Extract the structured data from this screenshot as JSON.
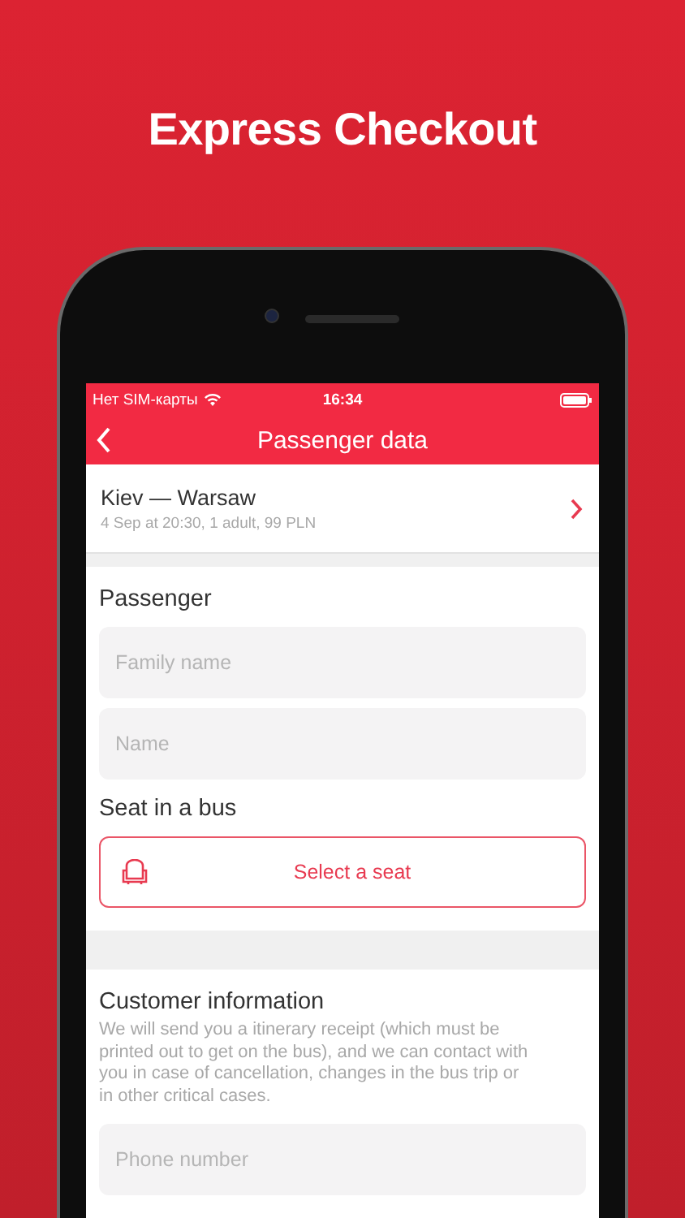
{
  "headline": "Express Checkout",
  "status_bar": {
    "carrier": "Нет SIM-карты",
    "time": "16:34"
  },
  "nav": {
    "title": "Passenger data"
  },
  "trip": {
    "route": "Kiev — Warsaw",
    "details": "4 Sep at 20:30, 1 adult, 99 PLN"
  },
  "passenger": {
    "title": "Passenger",
    "fields": [
      {
        "placeholder": "Family name"
      },
      {
        "placeholder": "Name"
      }
    ],
    "seat_title": "Seat in a bus",
    "seat_button": "Select a seat"
  },
  "customer": {
    "title": "Customer information",
    "note": "We will send you a itinerary receipt (which must be printed out to get on the bus), and we can contact with you in case of cancellation, changes in the bus trip or in other critical cases.",
    "fields": [
      {
        "placeholder": "Phone number"
      }
    ]
  }
}
